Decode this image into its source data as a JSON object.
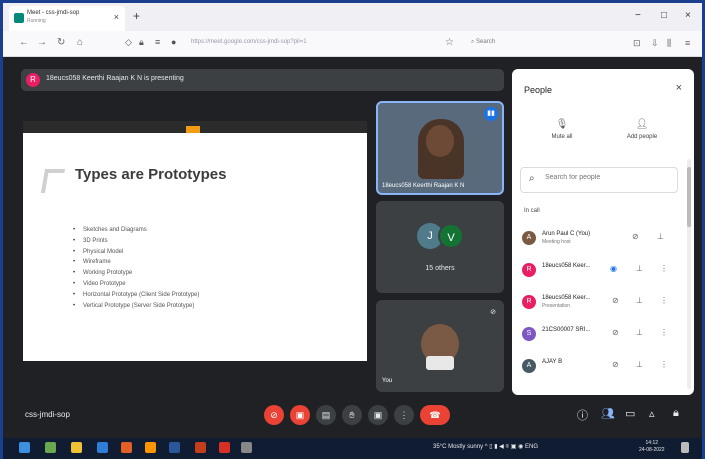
{
  "browser": {
    "tab_title": "Meet - css-jmdi-sop",
    "tab_subtitle": "Running",
    "tab_close": "×",
    "new_tab": "+",
    "url": "https://meet.google.com/css-jmdi-sop?pli=1",
    "search_label": "Search",
    "window_controls": [
      "−",
      "□",
      "×"
    ]
  },
  "meet": {
    "presenting_initial": "R",
    "presenting_text": "18eucs058 Keerthi Raajan K N is presenting",
    "slide": {
      "title": "Types are Prototypes",
      "bullets": [
        "Sketches and Diagrams",
        "3D Prints",
        "Physical Model",
        "Wireframe",
        "Working Prototype",
        "Video Prototype",
        "Horizontal Prototype (Client Side Prototype)",
        "Vertical Prototype (Server Side Prototype)"
      ]
    },
    "tiles": {
      "presenter_name": "18eucs058 Keerthi Raajan K N",
      "group_initials": [
        "J",
        "V"
      ],
      "others_label": "15 others",
      "self_label": "You"
    },
    "meeting_code": "css-jmdi-sop"
  },
  "people": {
    "title": "People",
    "close": "×",
    "mute_all": "Mute all",
    "add_people": "Add people",
    "search_placeholder": "Search for people",
    "in_call": "In call",
    "participants": [
      {
        "initial": "A",
        "name": "Arun Paul C (You)",
        "sub": "Meeting host",
        "color": "#7b5a43"
      },
      {
        "initial": "R",
        "name": "18eucs058 Keer...",
        "sub": "",
        "color": "#e91e63"
      },
      {
        "initial": "R",
        "name": "18eucs058 Keer...",
        "sub": "Presentation",
        "color": "#e91e63"
      },
      {
        "initial": "S",
        "name": "21CS00007 SRI...",
        "sub": "",
        "color": "#7e57c2"
      },
      {
        "initial": "A",
        "name": "AJAY B",
        "sub": "",
        "color": "#455a64"
      }
    ]
  },
  "taskbar": {
    "weather": "35°C Mostly sunny",
    "lang": "ENG",
    "time": "14:12",
    "date": "24-08-2022"
  }
}
